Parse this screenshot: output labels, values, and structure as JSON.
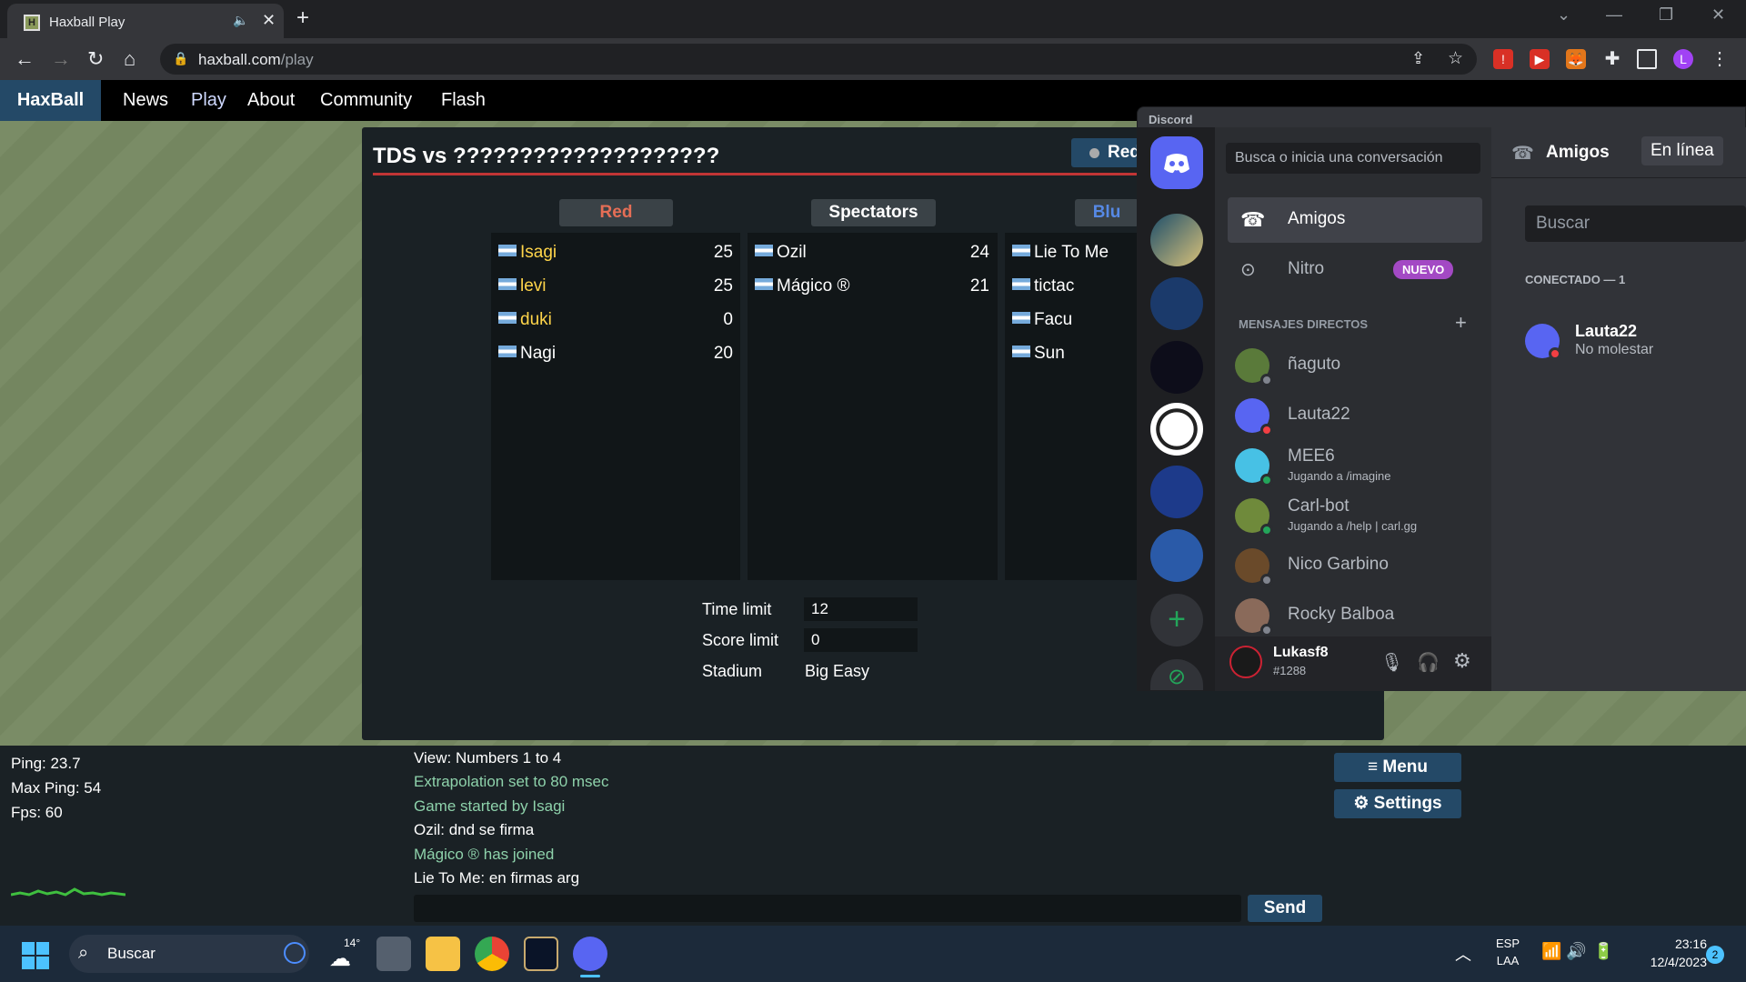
{
  "browser": {
    "tab_title": "Haxball Play",
    "url_host": "haxball.com",
    "url_path": "/play"
  },
  "site": {
    "brand": "HaxBall",
    "nav": [
      "News",
      "Play",
      "About",
      "Community",
      "Flash"
    ]
  },
  "room": {
    "title": "TDS vs ????????????????????",
    "team_button": "Red",
    "teams": {
      "red": {
        "label": "Red",
        "color": "#e56e56",
        "players": [
          {
            "name": "Isagi",
            "score": "25"
          },
          {
            "name": "levi",
            "score": "25"
          },
          {
            "name": "duki",
            "score": "0"
          },
          {
            "name": "Nagi",
            "score": "20"
          }
        ]
      },
      "spectators": {
        "label": "Spectators",
        "players": [
          {
            "name": "Ozil",
            "score": "24"
          },
          {
            "name": "Mágico ®",
            "score": "21"
          }
        ]
      },
      "blue": {
        "label": "Blu",
        "color": "#5689e5",
        "players": [
          {
            "name": "Lie To Me"
          },
          {
            "name": "tictac"
          },
          {
            "name": "Facu"
          },
          {
            "name": "Sun"
          }
        ]
      }
    },
    "settings": {
      "time_label": "Time limit",
      "time_value": "12",
      "score_label": "Score limit",
      "score_value": "0",
      "stadium_label": "Stadium",
      "stadium_value": "Big Easy"
    }
  },
  "stats": {
    "ping": "Ping: 23.7",
    "max_ping": "Max Ping: 54",
    "fps": "Fps: 60"
  },
  "chat": [
    {
      "text": "View: Numbers 1 to 4",
      "system": false
    },
    {
      "text": "Extrapolation set to 80 msec",
      "system": true
    },
    {
      "text": "Game started by Isagi",
      "system": true
    },
    {
      "text": "Ozil: dnd se firma",
      "system": false
    },
    {
      "text": "Mágico ® has joined",
      "system": true
    },
    {
      "text": "Lie To Me: en firmas arg",
      "system": false
    }
  ],
  "buttons": {
    "send": "Send",
    "menu": "Menu",
    "settings": "Settings"
  },
  "discord": {
    "title": "Discord",
    "search_placeholder": "Busca o inicia una conversación",
    "friends": "Amigos",
    "nitro": "Nitro",
    "nitro_badge": "NUEVO",
    "dm_header": "MENSAJES DIRECTOS",
    "dms": [
      {
        "name": "ñaguto",
        "sub": "",
        "color": "#5a7a3a",
        "status": "#80848e"
      },
      {
        "name": "Lauta22",
        "sub": "",
        "color": "#5865f2",
        "status": "#f23f43"
      },
      {
        "name": "MEE6",
        "sub": "Jugando a /imagine",
        "color": "#47c1e5",
        "status": "#23a55a"
      },
      {
        "name": "Carl-bot",
        "sub": "Jugando a /help | carl.gg",
        "color": "#6f8a3b",
        "status": "#23a55a"
      },
      {
        "name": "Nico Garbino",
        "sub": "",
        "color": "#6a4a2a",
        "status": "#80848e"
      },
      {
        "name": "Rocky Balboa",
        "sub": "",
        "color": "#8a6a5a",
        "status": "#80848e"
      }
    ],
    "user": {
      "name": "Lukasf8",
      "tag": "#1288"
    },
    "main": {
      "tab_friends": "Amigos",
      "tab_online": "En línea",
      "search_placeholder": "Buscar",
      "connected": "CONECTADO — 1",
      "friend_name": "Lauta22",
      "friend_status": "No molestar"
    }
  },
  "taskbar": {
    "search": "Buscar",
    "temp": "14°",
    "lang1": "ESP",
    "lang2": "LAA",
    "time": "23:16",
    "date": "12/4/2023",
    "notif": "2"
  }
}
